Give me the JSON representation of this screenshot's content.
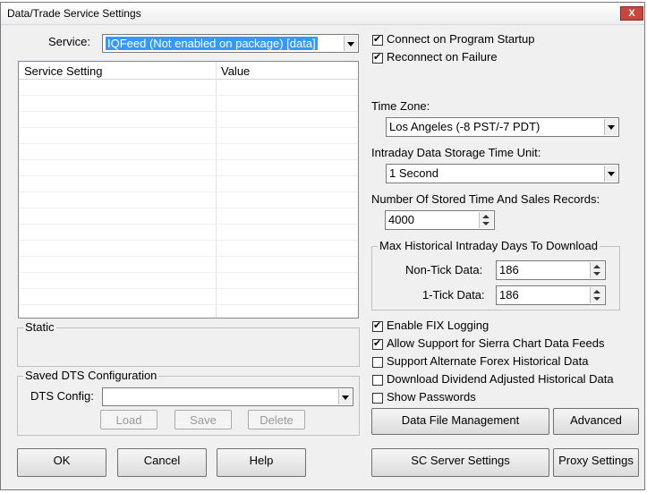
{
  "window": {
    "title": "Data/Trade Service Settings",
    "close_glyph": "X"
  },
  "service": {
    "label": "Service:",
    "value": "IQFeed (Not enabled on package)    [data]"
  },
  "grid": {
    "col_setting": "Service Setting",
    "col_value": "Value"
  },
  "static_group": {
    "label": "Static"
  },
  "dts": {
    "group_label": "Saved DTS Configuration",
    "config_label": "DTS Config:",
    "config_value": "",
    "load": "Load",
    "save": "Save",
    "delete": "Delete"
  },
  "options": {
    "connect_startup": {
      "label": "Connect on Program Startup",
      "checked": true
    },
    "reconnect_failure": {
      "label": "Reconnect on Failure",
      "checked": true
    }
  },
  "timezone": {
    "label": "Time Zone:",
    "value": "Los Angeles (-8 PST/-7 PDT)"
  },
  "storage_unit": {
    "label": "Intraday Data Storage Time Unit:",
    "value": "1 Second"
  },
  "ts_records": {
    "label": "Number Of Stored Time And Sales Records:",
    "value": "4000"
  },
  "max_days": {
    "group_label": "Max Historical Intraday Days To Download",
    "non_tick_label": "Non-Tick Data:",
    "non_tick_value": "186",
    "one_tick_label": "1-Tick Data:",
    "one_tick_value": "186"
  },
  "bottom_options": [
    {
      "label": "Enable FIX Logging",
      "checked": true
    },
    {
      "label": "Allow Support for Sierra Chart Data Feeds",
      "checked": true
    },
    {
      "label": "Support Alternate Forex Historical Data",
      "checked": false
    },
    {
      "label": "Download Dividend Adjusted Historical Data",
      "checked": false
    },
    {
      "label": "Show Passwords",
      "checked": false
    }
  ],
  "buttons": {
    "data_file_mgmt": "Data File Management",
    "advanced": "Advanced",
    "ok": "OK",
    "cancel": "Cancel",
    "help": "Help",
    "sc_server": "SC Server Settings",
    "proxy": "Proxy Settings"
  },
  "colors": {
    "selection": "#3399ff",
    "dialog_bg": "#f0f0f0",
    "close_red": "#c7463d"
  }
}
